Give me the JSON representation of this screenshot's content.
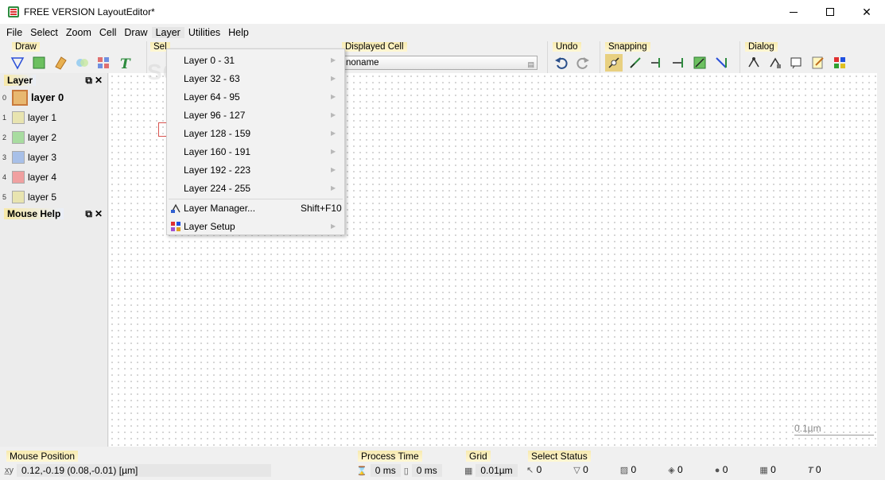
{
  "window": {
    "title": "FREE VERSION LayoutEditor*"
  },
  "menubar": {
    "items": [
      {
        "label": "File"
      },
      {
        "label": "Select"
      },
      {
        "label": "Zoom"
      },
      {
        "label": "Cell"
      },
      {
        "label": "Draw"
      },
      {
        "label": "Layer"
      },
      {
        "label": "Utilities"
      },
      {
        "label": "Help"
      }
    ]
  },
  "toolbars": {
    "draw": {
      "label": "Draw"
    },
    "select": {
      "label": "Sel"
    },
    "displayed_cell": {
      "label": "Displayed Cell",
      "value": "noname"
    },
    "undo": {
      "label": "Undo"
    },
    "snapping": {
      "label": "Snapping"
    },
    "dialog": {
      "label": "Dialog"
    }
  },
  "layer_menu": {
    "items": [
      {
        "label": "Layer 0 - 31"
      },
      {
        "label": "Layer 32 - 63"
      },
      {
        "label": "Layer 64 - 95"
      },
      {
        "label": "Layer 96 - 127"
      },
      {
        "label": "Layer 128 - 159"
      },
      {
        "label": "Layer 160 - 191"
      },
      {
        "label": "Layer 192 - 223"
      },
      {
        "label": "Layer 224 - 255"
      }
    ],
    "manager": {
      "label": "Layer Manager...",
      "shortcut": "Shift+F10"
    },
    "setup": {
      "label": "Layer Setup"
    }
  },
  "layer_panel": {
    "title": "Layer",
    "layers": [
      {
        "num": "0",
        "name": "layer 0",
        "color": "#e8b870"
      },
      {
        "num": "1",
        "name": "layer 1",
        "color": "#e8e4b0"
      },
      {
        "num": "2",
        "name": "layer 2",
        "color": "#a8dca0"
      },
      {
        "num": "3",
        "name": "layer 3",
        "color": "#a8c0e8"
      },
      {
        "num": "4",
        "name": "layer 4",
        "color": "#f0a0a0"
      },
      {
        "num": "5",
        "name": "layer 5",
        "color": "#e8e4b0"
      }
    ]
  },
  "mouse_help_panel": {
    "title": "Mouse Help"
  },
  "canvas": {
    "scale_label": "0.1µm"
  },
  "watermark": "SOFTPEDIA",
  "statusbar": {
    "mouse_position": {
      "label": "Mouse Position",
      "value": "0.12,-0.19 (0.08,-0.01) [µm]"
    },
    "process_time": {
      "label": "Process Time",
      "value1": "0 ms",
      "value2": "0 ms"
    },
    "grid": {
      "label": "Grid",
      "value": "0.01µm"
    },
    "select_status": {
      "label": "Select Status",
      "counts": [
        "0",
        "0",
        "0",
        "0",
        "0",
        "0",
        "0"
      ]
    }
  }
}
